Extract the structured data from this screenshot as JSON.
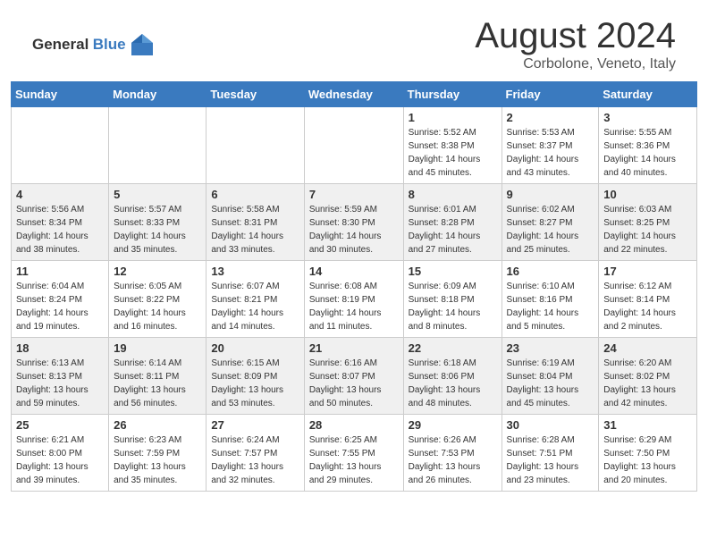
{
  "header": {
    "logo_general": "General",
    "logo_blue": "Blue",
    "month_title": "August 2024",
    "location": "Corbolone, Veneto, Italy"
  },
  "calendar": {
    "days_of_week": [
      "Sunday",
      "Monday",
      "Tuesday",
      "Wednesday",
      "Thursday",
      "Friday",
      "Saturday"
    ],
    "weeks": [
      [
        {
          "day": "",
          "info": ""
        },
        {
          "day": "",
          "info": ""
        },
        {
          "day": "",
          "info": ""
        },
        {
          "day": "",
          "info": ""
        },
        {
          "day": "1",
          "info": "Sunrise: 5:52 AM\nSunset: 8:38 PM\nDaylight: 14 hours\nand 45 minutes."
        },
        {
          "day": "2",
          "info": "Sunrise: 5:53 AM\nSunset: 8:37 PM\nDaylight: 14 hours\nand 43 minutes."
        },
        {
          "day": "3",
          "info": "Sunrise: 5:55 AM\nSunset: 8:36 PM\nDaylight: 14 hours\nand 40 minutes."
        }
      ],
      [
        {
          "day": "4",
          "info": "Sunrise: 5:56 AM\nSunset: 8:34 PM\nDaylight: 14 hours\nand 38 minutes."
        },
        {
          "day": "5",
          "info": "Sunrise: 5:57 AM\nSunset: 8:33 PM\nDaylight: 14 hours\nand 35 minutes."
        },
        {
          "day": "6",
          "info": "Sunrise: 5:58 AM\nSunset: 8:31 PM\nDaylight: 14 hours\nand 33 minutes."
        },
        {
          "day": "7",
          "info": "Sunrise: 5:59 AM\nSunset: 8:30 PM\nDaylight: 14 hours\nand 30 minutes."
        },
        {
          "day": "8",
          "info": "Sunrise: 6:01 AM\nSunset: 8:28 PM\nDaylight: 14 hours\nand 27 minutes."
        },
        {
          "day": "9",
          "info": "Sunrise: 6:02 AM\nSunset: 8:27 PM\nDaylight: 14 hours\nand 25 minutes."
        },
        {
          "day": "10",
          "info": "Sunrise: 6:03 AM\nSunset: 8:25 PM\nDaylight: 14 hours\nand 22 minutes."
        }
      ],
      [
        {
          "day": "11",
          "info": "Sunrise: 6:04 AM\nSunset: 8:24 PM\nDaylight: 14 hours\nand 19 minutes."
        },
        {
          "day": "12",
          "info": "Sunrise: 6:05 AM\nSunset: 8:22 PM\nDaylight: 14 hours\nand 16 minutes."
        },
        {
          "day": "13",
          "info": "Sunrise: 6:07 AM\nSunset: 8:21 PM\nDaylight: 14 hours\nand 14 minutes."
        },
        {
          "day": "14",
          "info": "Sunrise: 6:08 AM\nSunset: 8:19 PM\nDaylight: 14 hours\nand 11 minutes."
        },
        {
          "day": "15",
          "info": "Sunrise: 6:09 AM\nSunset: 8:18 PM\nDaylight: 14 hours\nand 8 minutes."
        },
        {
          "day": "16",
          "info": "Sunrise: 6:10 AM\nSunset: 8:16 PM\nDaylight: 14 hours\nand 5 minutes."
        },
        {
          "day": "17",
          "info": "Sunrise: 6:12 AM\nSunset: 8:14 PM\nDaylight: 14 hours\nand 2 minutes."
        }
      ],
      [
        {
          "day": "18",
          "info": "Sunrise: 6:13 AM\nSunset: 8:13 PM\nDaylight: 13 hours\nand 59 minutes."
        },
        {
          "day": "19",
          "info": "Sunrise: 6:14 AM\nSunset: 8:11 PM\nDaylight: 13 hours\nand 56 minutes."
        },
        {
          "day": "20",
          "info": "Sunrise: 6:15 AM\nSunset: 8:09 PM\nDaylight: 13 hours\nand 53 minutes."
        },
        {
          "day": "21",
          "info": "Sunrise: 6:16 AM\nSunset: 8:07 PM\nDaylight: 13 hours\nand 50 minutes."
        },
        {
          "day": "22",
          "info": "Sunrise: 6:18 AM\nSunset: 8:06 PM\nDaylight: 13 hours\nand 48 minutes."
        },
        {
          "day": "23",
          "info": "Sunrise: 6:19 AM\nSunset: 8:04 PM\nDaylight: 13 hours\nand 45 minutes."
        },
        {
          "day": "24",
          "info": "Sunrise: 6:20 AM\nSunset: 8:02 PM\nDaylight: 13 hours\nand 42 minutes."
        }
      ],
      [
        {
          "day": "25",
          "info": "Sunrise: 6:21 AM\nSunset: 8:00 PM\nDaylight: 13 hours\nand 39 minutes."
        },
        {
          "day": "26",
          "info": "Sunrise: 6:23 AM\nSunset: 7:59 PM\nDaylight: 13 hours\nand 35 minutes."
        },
        {
          "day": "27",
          "info": "Sunrise: 6:24 AM\nSunset: 7:57 PM\nDaylight: 13 hours\nand 32 minutes."
        },
        {
          "day": "28",
          "info": "Sunrise: 6:25 AM\nSunset: 7:55 PM\nDaylight: 13 hours\nand 29 minutes."
        },
        {
          "day": "29",
          "info": "Sunrise: 6:26 AM\nSunset: 7:53 PM\nDaylight: 13 hours\nand 26 minutes."
        },
        {
          "day": "30",
          "info": "Sunrise: 6:28 AM\nSunset: 7:51 PM\nDaylight: 13 hours\nand 23 minutes."
        },
        {
          "day": "31",
          "info": "Sunrise: 6:29 AM\nSunset: 7:50 PM\nDaylight: 13 hours\nand 20 minutes."
        }
      ]
    ]
  }
}
